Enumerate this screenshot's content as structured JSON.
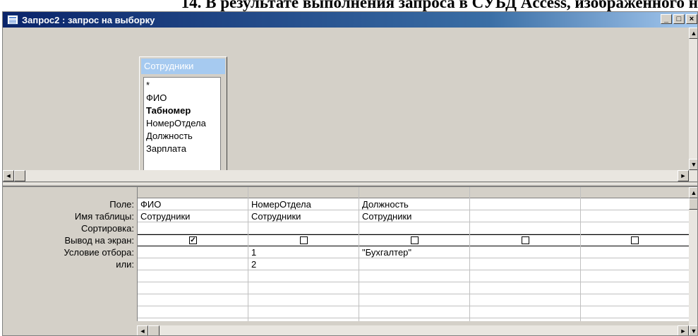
{
  "document": {
    "heading": "14. В результате выполнения запроса в СУБД Access, изображенного н"
  },
  "window": {
    "title": "Запрос2 : запрос на выборку",
    "controls": {
      "minimize": "_",
      "maximize": "□",
      "close": "×"
    }
  },
  "table": {
    "name": "Сотрудники",
    "fields": [
      {
        "label": "*",
        "bold": false
      },
      {
        "label": "ФИО",
        "bold": false
      },
      {
        "label": "Табномер",
        "bold": true
      },
      {
        "label": "НомерОтдела",
        "bold": false
      },
      {
        "label": "Должность",
        "bold": false
      },
      {
        "label": "Зарплата",
        "bold": false
      }
    ]
  },
  "grid": {
    "row_labels": {
      "field": "Поле:",
      "table": "Имя таблицы:",
      "sort": "Сортировка:",
      "show": "Вывод на экран:",
      "criteria": "Условие отбора:",
      "or": "или:"
    },
    "columns": [
      {
        "field": "ФИО",
        "table": "Сотрудники",
        "sort": "",
        "show": true,
        "criteria": "",
        "or": ""
      },
      {
        "field": "НомерОтдела",
        "table": "Сотрудники",
        "sort": "",
        "show": false,
        "criteria": "1",
        "or": "2"
      },
      {
        "field": "Должность",
        "table": "Сотрудники",
        "sort": "",
        "show": false,
        "criteria": "\"Бухгалтер\"",
        "or": ""
      },
      {
        "field": "",
        "table": "",
        "sort": "",
        "show": false,
        "criteria": "",
        "or": ""
      },
      {
        "field": "",
        "table": "",
        "sort": "",
        "show": false,
        "criteria": "",
        "or": ""
      }
    ]
  },
  "icons": {
    "query-icon": "query-icon",
    "scroll-left": "◄",
    "scroll-right": "►",
    "scroll-up": "▲",
    "scroll-down": "▼",
    "check": "✓"
  }
}
